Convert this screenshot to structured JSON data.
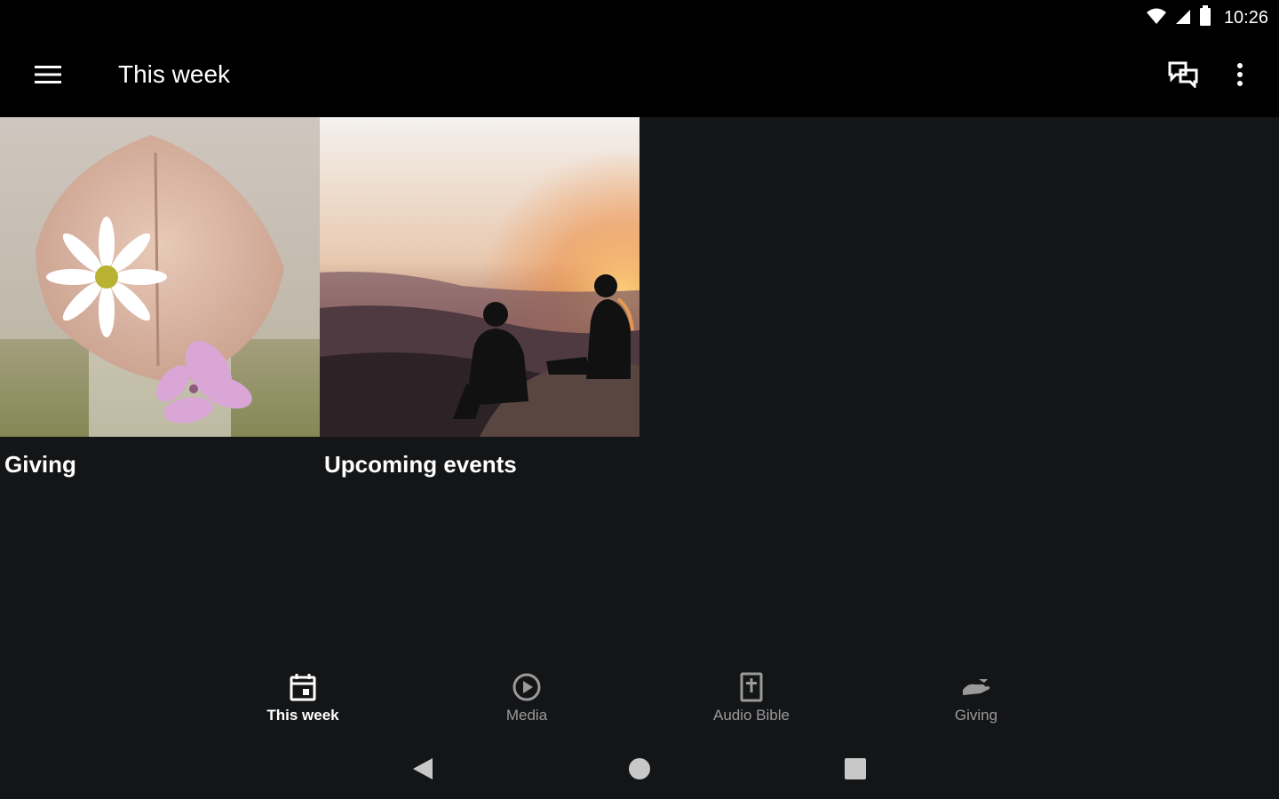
{
  "status_bar": {
    "time": "10:26",
    "icons": [
      "wifi-icon",
      "cell-signal-icon",
      "battery-icon"
    ]
  },
  "app_bar": {
    "title": "This week",
    "menu_icon": "hamburger-menu-icon",
    "actions": [
      "chat-icon",
      "more-vert-icon"
    ]
  },
  "cards": [
    {
      "title": "Giving",
      "image": "hands-holding-flowers-photo"
    },
    {
      "title": "Upcoming events",
      "image": "sunset-mountain-people-photo"
    }
  ],
  "bottom_nav": {
    "items": [
      {
        "label": "This week",
        "icon": "calendar-icon",
        "active": true
      },
      {
        "label": "Media",
        "icon": "play-circle-icon",
        "active": false
      },
      {
        "label": "Audio Bible",
        "icon": "bible-icon",
        "active": false
      },
      {
        "label": "Giving",
        "icon": "giving-hand-icon",
        "active": false
      }
    ]
  },
  "system_nav": [
    "back-icon",
    "home-icon",
    "recents-icon"
  ],
  "colors": {
    "background": "#141517",
    "app_bar": "#000000",
    "text": "#ffffff",
    "inactive": "#9a9a9a"
  }
}
